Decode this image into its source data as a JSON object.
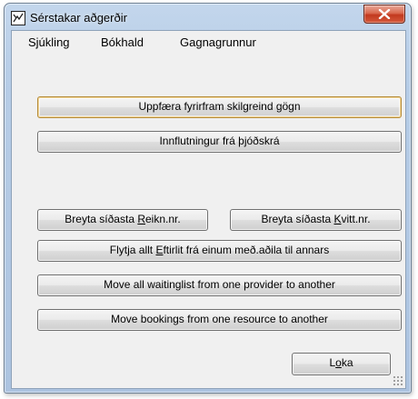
{
  "window": {
    "title": "Sérstakar aðgerðir"
  },
  "menu": {
    "items": [
      "Sjúkling",
      "Bókhald",
      "Gagnagrunnur"
    ]
  },
  "buttons": {
    "update_predefined": "Uppfæra fyrirfram skilgreind gögn",
    "import_registry": "Innflutningur frá þjóðskrá",
    "change_last_invoice": {
      "pre": "Breyta síðasta ",
      "accel": "R",
      "post": "eikn.nr."
    },
    "change_last_receipt": {
      "pre": "Breyta síðasta ",
      "accel": "K",
      "post": "vitt.nr."
    },
    "move_followups": {
      "pre": "Flytja allt ",
      "accel": "E",
      "post": "ftirlit frá einum með.aðila til annars"
    },
    "move_waitinglist": "Move all waitinglist from one provider to another",
    "move_bookings": "Move bookings from one resource to another",
    "close": {
      "pre": "L",
      "accel": "o",
      "post": "ka"
    }
  },
  "icons": {
    "app": "app-window-icon",
    "close": "close-icon",
    "resize": "resize-grip-icon"
  }
}
